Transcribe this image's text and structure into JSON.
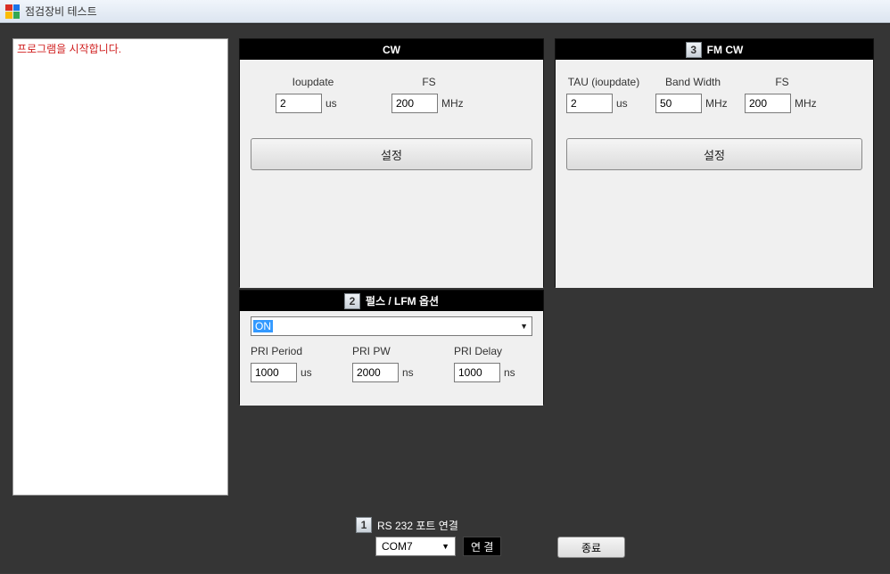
{
  "window": {
    "title": "점검장비 테스트"
  },
  "log": {
    "message": "프로그램을 시작합니다."
  },
  "cw": {
    "title": "CW",
    "ioupdate_label": "Ioupdate",
    "ioupdate_value": "2",
    "ioupdate_unit": "us",
    "fs_label": "FS",
    "fs_value": "200",
    "fs_unit": "MHz",
    "submit": "설정"
  },
  "fmcw": {
    "badge": "3",
    "title": "FM CW",
    "tau_label": "TAU (ioupdate)",
    "tau_value": "2",
    "tau_unit": "us",
    "bw_label": "Band Width",
    "bw_value": "50",
    "bw_unit": "MHz",
    "fs_label": "FS",
    "fs_value": "200",
    "fs_unit": "MHz",
    "submit": "설정"
  },
  "pulse": {
    "badge": "2",
    "title": "펄스 / LFM 옵션",
    "mode_value": "ON",
    "pri_period_label": "PRI Period",
    "pri_period_value": "1000",
    "pri_period_unit": "us",
    "pri_pw_label": "PRI PW",
    "pri_pw_value": "2000",
    "pri_pw_unit": "ns",
    "pri_delay_label": "PRI Delay",
    "pri_delay_value": "1000",
    "pri_delay_unit": "ns"
  },
  "rs232": {
    "badge": "1",
    "label": "RS 232 포트 연결",
    "port": "COM7",
    "connect": "연 결"
  },
  "exit": {
    "label": "종료"
  }
}
